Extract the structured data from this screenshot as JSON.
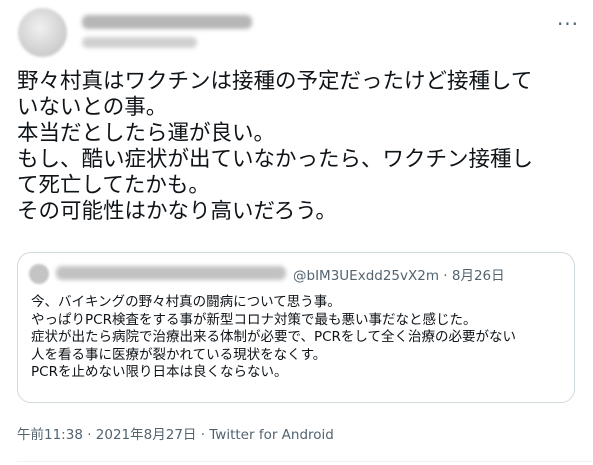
{
  "tweet": {
    "lines": [
      "野々村真はワクチンは接種の予定だったけど接種して",
      "いないとの事。",
      "本当だとしたら運が良い。",
      "もし、酷い症状が出ていなかったら、ワクチン接種し",
      "て死亡してたかも。",
      "その可能性はかなり高いだろう。"
    ],
    "more_label": "···"
  },
  "quote": {
    "handle": "@bIM3UExdd25vX2m",
    "separator": " · ",
    "date": "8月26日",
    "lines": [
      "今、バイキングの野々村真の闘病について思う事。",
      "やっぱりPCR検査をする事が新型コロナ対策で最も悪い事だなと感じた。",
      "症状が出たら病院で治療出来る体制が必要で、PCRをして全く治療の必要がない",
      "人を看る事に医療が裂かれている現状をなくす。",
      "PCRを止めない限り日本は良くならない。"
    ]
  },
  "footer": {
    "time": "午前11:38",
    "sep1": " · ",
    "date": "2021年8月27日",
    "sep2": " · ",
    "source": "Twitter for Android"
  }
}
